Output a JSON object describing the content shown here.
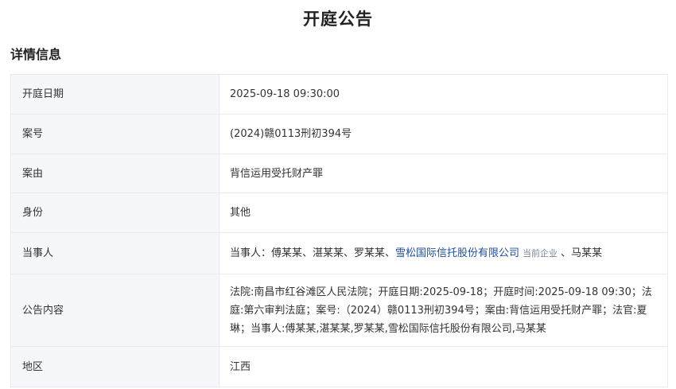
{
  "page": {
    "title": "开庭公告",
    "section_title": "详情信息"
  },
  "rows": [
    {
      "label": "开庭日期",
      "value": "2025-09-18 09:30:00"
    },
    {
      "label": "案号",
      "value": "(2024)赣0113刑初394号"
    },
    {
      "label": "案由",
      "value": "背信运用受托财产罪"
    },
    {
      "label": "身份",
      "value": "其他"
    },
    {
      "label": "当事人"
    },
    {
      "label": "公告内容",
      "value": "法院:南昌市红谷滩区人民法院；开庭日期:2025-09-18；开庭时间:2025-09-18 09:30；法庭:第六审判法庭；案号:（2024）赣0113刑初394号；案由:背信运用受托财产罪；法官:夏琳；当事人:傅某某,湛某某,罗某某,雪松国际信托股份有限公司,马某某"
    },
    {
      "label": "地区",
      "value": "江西"
    }
  ],
  "parties": {
    "prefix": "当事人：傅某某、湛某某、罗某某、",
    "company": "雪松国际信托股份有限公司",
    "company_tag": "当前企业",
    "suffix": "、马某某"
  }
}
